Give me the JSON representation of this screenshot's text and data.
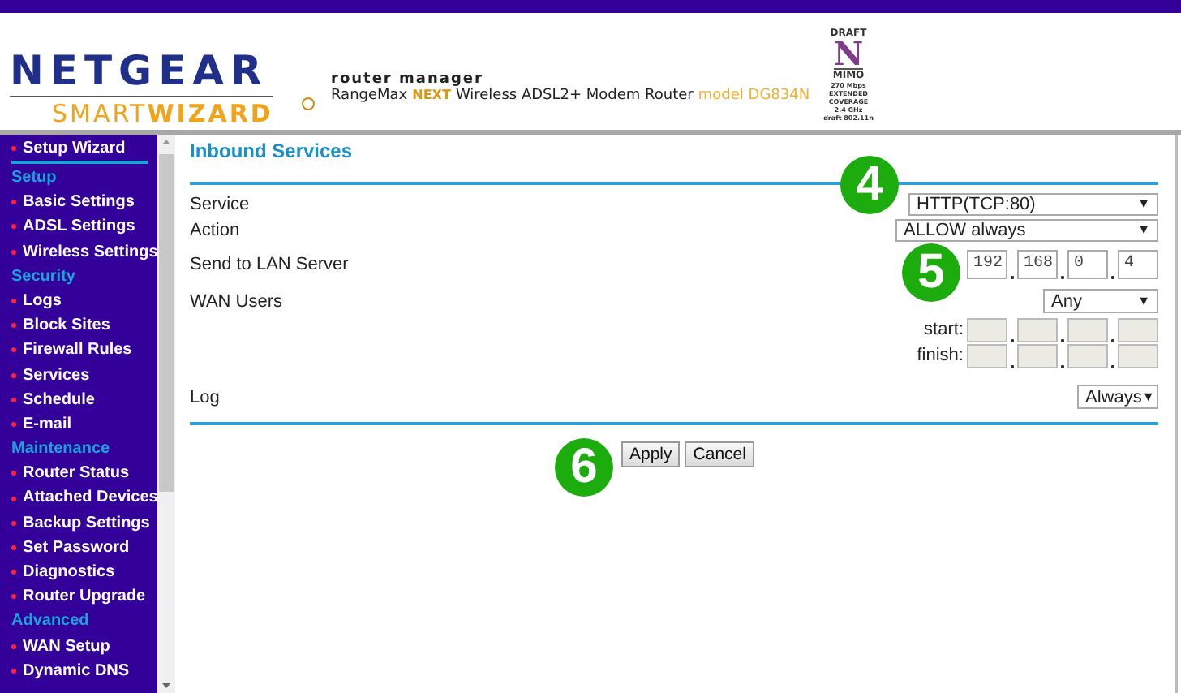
{
  "header": {
    "logo": "NETGEAR",
    "product": "SMART**WIZARD**",
    "tagline": "router manager",
    "range": "RangeMax",
    "range_next": "NEXT",
    "description": "Wireless ADSL2+ Modem Router",
    "model": "model DG834N",
    "badge": [
      "DRAFT",
      "N",
      "MIMO",
      "270 Mbps",
      "EXTENDED",
      "COVERAGE",
      "2.4 GHz",
      "draft 802.11n"
    ]
  },
  "sidebar": {
    "items": [
      {
        "kind": "wizard",
        "label": "Setup Wizard"
      },
      {
        "kind": "section",
        "label": "Setup"
      },
      {
        "kind": "link",
        "label": "Basic Settings"
      },
      {
        "kind": "link",
        "label": "ADSL Settings"
      },
      {
        "kind": "link",
        "label": "Wireless Settings"
      },
      {
        "kind": "section",
        "label": "Security"
      },
      {
        "kind": "link",
        "label": "Logs"
      },
      {
        "kind": "link",
        "label": "Block Sites"
      },
      {
        "kind": "link",
        "label": "Firewall Rules"
      },
      {
        "kind": "link",
        "label": "Services"
      },
      {
        "kind": "link",
        "label": "Schedule"
      },
      {
        "kind": "link",
        "label": "E-mail"
      },
      {
        "kind": "section",
        "label": "Maintenance"
      },
      {
        "kind": "link",
        "label": "Router Status"
      },
      {
        "kind": "link",
        "label": "Attached Devices"
      },
      {
        "kind": "link",
        "label": "Backup Settings"
      },
      {
        "kind": "link",
        "label": "Set Password"
      },
      {
        "kind": "link",
        "label": "Diagnostics"
      },
      {
        "kind": "link",
        "label": "Router Upgrade"
      },
      {
        "kind": "section",
        "label": "Advanced"
      },
      {
        "kind": "link",
        "label": "WAN Setup"
      },
      {
        "kind": "link",
        "label": "Dynamic DNS"
      }
    ]
  },
  "form": {
    "title": "Inbound Services",
    "rows": [
      {
        "kind": "select",
        "label": "Service",
        "value": "HTTP(TCP:80)",
        "arrow": "▼"
      },
      {
        "kind": "select",
        "label": "Action",
        "value": "ALLOW always",
        "arrow": "▼"
      },
      {
        "kind": "ip",
        "label": "Send to LAN Server",
        "octets": [
          "192",
          "168",
          "0",
          "4"
        ],
        "disabled": false
      },
      {
        "kind": "select",
        "label": "WAN Users",
        "value": "Any",
        "arrow": "▼"
      },
      {
        "kind": "ip",
        "label": "start:",
        "disabled": true
      },
      {
        "kind": "ip",
        "label": "finish:",
        "disabled": true
      },
      {
        "kind": "select",
        "label": "Log",
        "value": "Always",
        "arrow": "▼"
      }
    ],
    "buttons": [
      "Apply",
      "Cancel"
    ]
  },
  "markers": [
    "4",
    "5",
    "6"
  ]
}
